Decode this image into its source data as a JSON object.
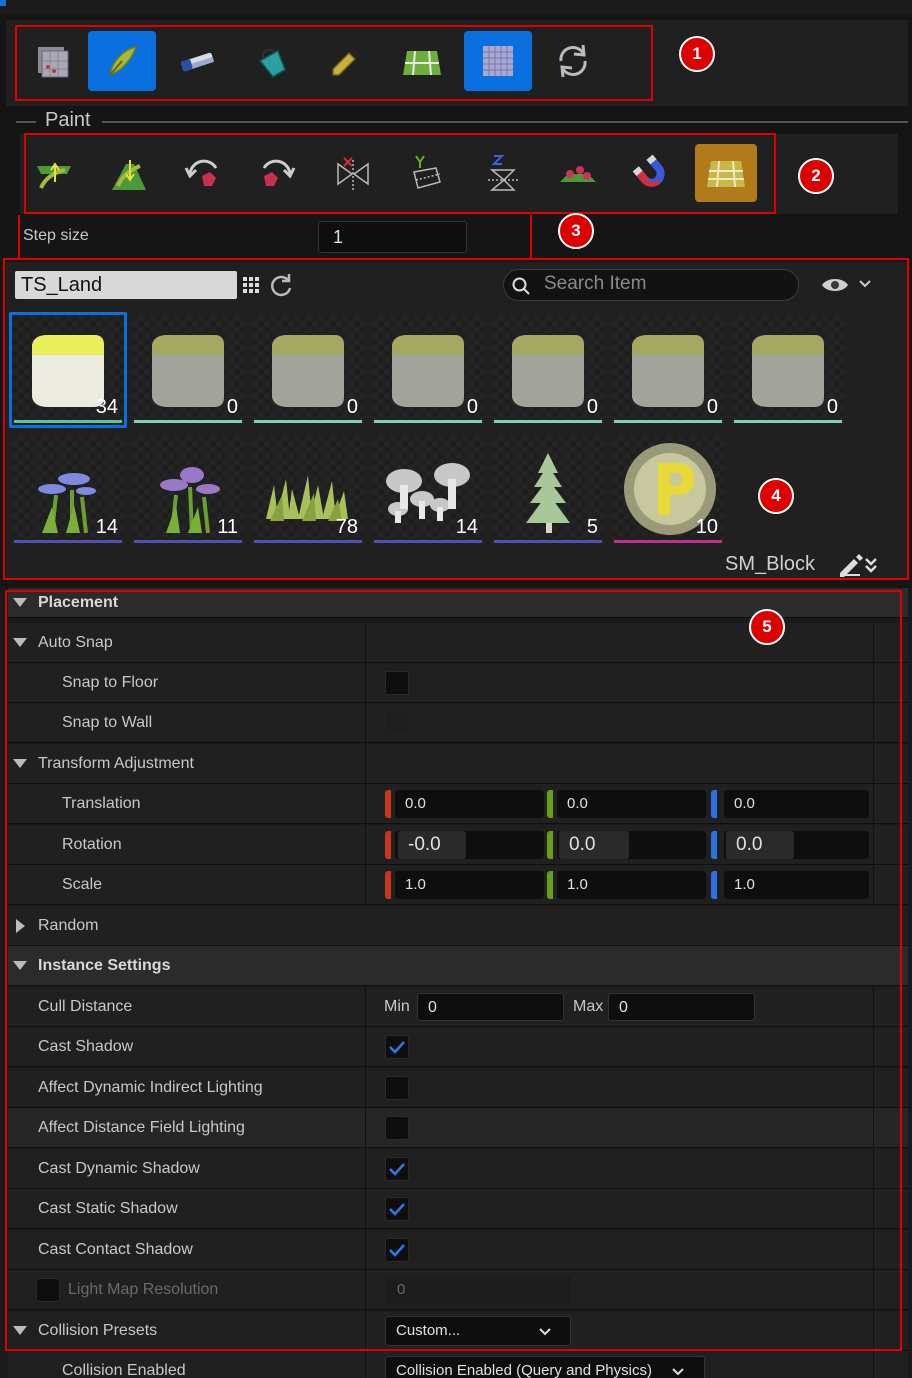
{
  "toolbar": {
    "tools": [
      {
        "name": "select-tool",
        "icon": "select-grid-icon",
        "active": false
      },
      {
        "name": "paint-tool",
        "icon": "paint-brush-icon",
        "active": true
      },
      {
        "name": "erase-tool",
        "icon": "eraser-icon",
        "active": false
      },
      {
        "name": "fill-tool",
        "icon": "paint-bucket-icon",
        "active": false
      },
      {
        "name": "pick-tool",
        "icon": "eyedropper-icon",
        "active": false
      },
      {
        "name": "tileset-tool",
        "icon": "tileset-icon",
        "active": false
      },
      {
        "name": "grid-tool",
        "icon": "grid-icon",
        "active": true
      },
      {
        "name": "refresh-tool",
        "icon": "refresh-icon",
        "active": false
      }
    ]
  },
  "markers": [
    "1",
    "2",
    "3",
    "4",
    "5"
  ],
  "paint": {
    "title": "Paint",
    "tools": [
      "raise-icon",
      "lower-icon",
      "rotate-left-icon",
      "rotate-right-icon",
      "mirror-x-icon",
      "mirror-y-icon",
      "mirror-z-icon",
      "scatter-icon",
      "magnet-icon",
      "tile-grid-icon"
    ]
  },
  "step": {
    "label": "Step size",
    "value": "1"
  },
  "palette": {
    "tileset_name": "TS_Land",
    "search_placeholder": "Search Item",
    "selected_item": "SM_Block",
    "items": [
      {
        "kind": "block",
        "count": "34",
        "bar": "#5fc3a0",
        "selected": true
      },
      {
        "kind": "block",
        "count": "0",
        "bar": "#7dd4b0"
      },
      {
        "kind": "block",
        "count": "0",
        "bar": "#7dd4b0"
      },
      {
        "kind": "block",
        "count": "0",
        "bar": "#7dd4b0"
      },
      {
        "kind": "block",
        "count": "0",
        "bar": "#7dd4b0"
      },
      {
        "kind": "block",
        "count": "0",
        "bar": "#7dd4b0"
      },
      {
        "kind": "block",
        "count": "0",
        "bar": "#7dd4b0"
      },
      {
        "kind": "flower-blue",
        "count": "14",
        "bar": "#5050b0"
      },
      {
        "kind": "flower-purple",
        "count": "11",
        "bar": "#5050b0"
      },
      {
        "kind": "grass",
        "count": "78",
        "bar": "#5050b0"
      },
      {
        "kind": "mushroom",
        "count": "14",
        "bar": "#5050b0"
      },
      {
        "kind": "tree",
        "count": "5",
        "bar": "#5050b0"
      },
      {
        "kind": "coin",
        "count": "10",
        "bar": "#c03090"
      }
    ]
  },
  "details": {
    "placement": "Placement",
    "auto_snap": "Auto Snap",
    "snap_floor": "Snap to Floor",
    "snap_wall": "Snap to Wall",
    "transform": "Transform Adjustment",
    "translation": {
      "label": "Translation",
      "x": "0.0",
      "y": "0.0",
      "z": "0.0"
    },
    "rotation": {
      "label": "Rotation",
      "x": "-0.0",
      "y": "0.0",
      "z": "0.0"
    },
    "scale": {
      "label": "Scale",
      "x": "1.0",
      "y": "1.0",
      "z": "1.0"
    },
    "random": "Random",
    "instance_settings": "Instance Settings",
    "cull_distance": {
      "label": "Cull Distance",
      "min_label": "Min",
      "min": "0",
      "max_label": "Max",
      "max": "0"
    },
    "cast_shadow": {
      "label": "Cast Shadow",
      "checked": true
    },
    "affect_dynamic": {
      "label": "Affect Dynamic Indirect Lighting",
      "checked": false
    },
    "affect_distance": {
      "label": "Affect Distance Field Lighting",
      "checked": false
    },
    "cast_dynamic": {
      "label": "Cast Dynamic Shadow",
      "checked": true
    },
    "cast_static": {
      "label": "Cast Static Shadow",
      "checked": true
    },
    "cast_contact": {
      "label": "Cast Contact Shadow",
      "checked": true
    },
    "light_map": {
      "label": "Light Map Resolution",
      "value": "0"
    },
    "collision_presets": {
      "label": "Collision Presets",
      "value": "Custom..."
    },
    "collision_enabled": {
      "label": "Collision Enabled",
      "value": "Collision Enabled (Query and Physics)"
    }
  },
  "colors": {
    "accent": "#0a70e0",
    "annotation": "#e00000",
    "x_axis": "#c8341c",
    "y_axis": "#6aa018",
    "z_axis": "#2c72e0"
  }
}
